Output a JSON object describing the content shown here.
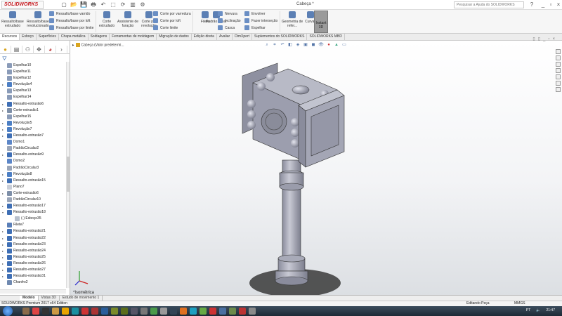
{
  "app": {
    "logo": "SOLIDWORKS",
    "doc_title": "Cabeça *",
    "help_placeholder": "Pesquisar a Ajuda do SOLIDWORKS"
  },
  "quick_access": [
    "new-icon",
    "open-icon",
    "save-icon",
    "print-icon",
    "undo-icon",
    "select-icon",
    "rebuild-icon",
    "file-props-icon",
    "options-icon"
  ],
  "ribbon": {
    "big": [
      "Ressalto/base extrudado",
      "Ressalto/base revolucionado",
      "Corte extrudado",
      "Assistente de furação",
      "Corte por revolução",
      "Filete",
      "Padrão linear",
      "Geometria de refer...",
      "Curvas"
    ],
    "small_boss": [
      "Ressalto/base varrido",
      "Ressalto/base por loft",
      "Ressalto/base por limite"
    ],
    "small_cut": [
      "Corte por varredura",
      "Corte por loft",
      "Corte limite"
    ],
    "small_feat": [
      "Nervura",
      "Inclinação",
      "Casca"
    ],
    "small_feat2": [
      "Envolver",
      "Fazer interseção",
      "Espelhar"
    ],
    "instant3d": "Instant 3D"
  },
  "tabs": [
    "Recursos",
    "Esboço",
    "Superfícies",
    "Chapa metálica",
    "Soldagens",
    "Ferramentas de moldagem",
    "Migração de dados",
    "Edição direta",
    "Avaliar",
    "DimXpert",
    "Suplementos do SOLIDWORKS",
    "SOLIDWORKS MBD"
  ],
  "tree": [
    {
      "label": "Espelhar10",
      "type": "mirror",
      "exp": false
    },
    {
      "label": "Espelhar11",
      "type": "mirror",
      "exp": false
    },
    {
      "label": "Espelhar12",
      "type": "mirror",
      "exp": false
    },
    {
      "label": "Revolução4",
      "type": "revolve",
      "exp": true
    },
    {
      "label": "Espelhar13",
      "type": "mirror",
      "exp": false
    },
    {
      "label": "Espelhar14",
      "type": "mirror",
      "exp": false
    },
    {
      "label": "Ressalto-extrusão6",
      "type": "extrude",
      "exp": true
    },
    {
      "label": "Corte-extrusão1",
      "type": "cut",
      "exp": true
    },
    {
      "label": "Espelhar15",
      "type": "mirror",
      "exp": false
    },
    {
      "label": "Revolução5",
      "type": "revolve",
      "exp": true
    },
    {
      "label": "Revolução7",
      "type": "revolve",
      "exp": true
    },
    {
      "label": "Ressalto-extrusão7",
      "type": "extrude",
      "exp": true
    },
    {
      "label": "Domo1",
      "type": "dome",
      "exp": false
    },
    {
      "label": "PadrãoCircular2",
      "type": "pattern",
      "exp": false
    },
    {
      "label": "Ressalto-extrusão9",
      "type": "extrude",
      "exp": true
    },
    {
      "label": "Domo2",
      "type": "dome",
      "exp": false
    },
    {
      "label": "PadrãoCircular3",
      "type": "pattern",
      "exp": false
    },
    {
      "label": "Revolução8",
      "type": "revolve",
      "exp": true
    },
    {
      "label": "Ressalto-extrusão15",
      "type": "extrude",
      "exp": true
    },
    {
      "label": "Plano7",
      "type": "plane",
      "exp": false
    },
    {
      "label": "Corte-extrusão6",
      "type": "cut",
      "exp": true
    },
    {
      "label": "PadrãoCircular10",
      "type": "pattern",
      "exp": false
    },
    {
      "label": "Ressalto-extrusão17",
      "type": "extrude",
      "exp": true
    },
    {
      "label": "Ressalto-extrusão18",
      "type": "extrude",
      "exp": true,
      "open": true
    },
    {
      "label": "(-) Esboço35",
      "type": "sketch",
      "exp": false,
      "child": true
    },
    {
      "label": "Filete7",
      "type": "fillet",
      "exp": false
    },
    {
      "label": "Ressalto-extrusão21",
      "type": "extrude",
      "exp": true
    },
    {
      "label": "Ressalto-extrusão22",
      "type": "extrude",
      "exp": true
    },
    {
      "label": "Ressalto-extrusão23",
      "type": "extrude",
      "exp": true
    },
    {
      "label": "Ressalto-extrusão24",
      "type": "extrude",
      "exp": true
    },
    {
      "label": "Ressalto-extrusão25",
      "type": "extrude",
      "exp": true
    },
    {
      "label": "Ressalto-extrusão26",
      "type": "extrude",
      "exp": true
    },
    {
      "label": "Ressalto-extrusão27",
      "type": "extrude",
      "exp": true
    },
    {
      "label": "Ressalto-extrusão31",
      "type": "extrude",
      "exp": true
    },
    {
      "label": "Chanfro2",
      "type": "chamfer",
      "exp": false
    }
  ],
  "icon_colors": {
    "mirror": "#8a9bb8",
    "revolve": "#4d7fc4",
    "extrude": "#3f6fb5",
    "cut": "#7e8fa8",
    "dome": "#5c86c8",
    "pattern": "#9aa5b8",
    "plane": "#c9ced8",
    "sketch": "#b8c0cc",
    "fillet": "#5a7fb8",
    "chamfer": "#6f89b0"
  },
  "viewport": {
    "breadcrumb": "Cabeça  (Valor predetermi...",
    "view_name": "*Isométrica"
  },
  "bottom_tabs": [
    "Modelo",
    "Vistas 3D",
    "Estudo de movimento 1"
  ],
  "status": {
    "edition": "SOLIDWORKS Premium 2017 x64 Edition",
    "mode": "Editando Peça",
    "units": "MMGS"
  },
  "taskbar": {
    "lang": "PT",
    "time": "21:47",
    "apps": [
      "#8a6a4a",
      "#d44",
      "#333",
      "#c94",
      "#e8a400",
      "#1a8fa0",
      "#c33",
      "#a33",
      "#2a5d9a",
      "#7a8a2a",
      "#5b6d1b",
      "#556",
      "#777",
      "#4a9a4a",
      "#999",
      "#345",
      "#e07020",
      "#1ca0c0",
      "#6a4",
      "#c33",
      "#4a6fa0",
      "#6b8a4a",
      "#b33",
      "#8a8a8a"
    ]
  }
}
